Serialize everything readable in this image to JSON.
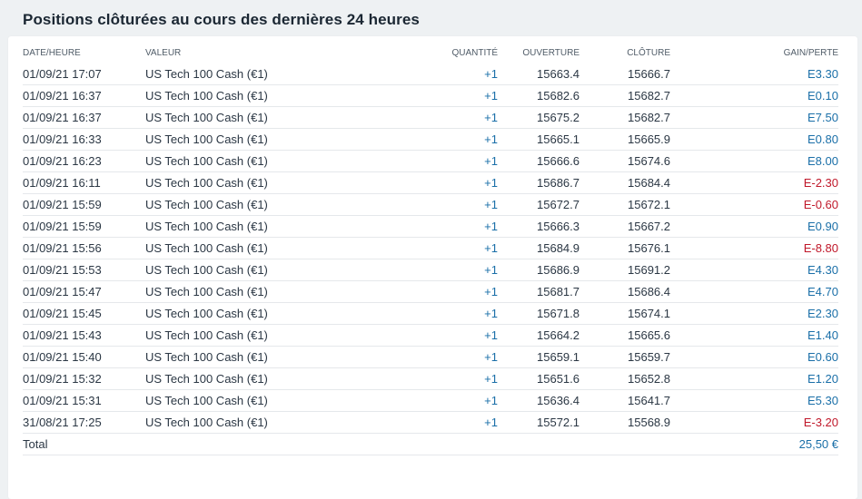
{
  "page": {
    "title": "Positions clôturées au cours des dernières 24 heures"
  },
  "table": {
    "headers": {
      "date": "DATE/HEURE",
      "value": "VALEUR",
      "quantity": "QUANTITÉ",
      "open": "OUVERTURE",
      "close": "CLÔTURE",
      "gain": "GAIN/PERTE"
    },
    "rows": [
      {
        "date": "01/09/21 17:07",
        "value": "US Tech 100 Cash (€1)",
        "qty": "+1",
        "open": "15663.4",
        "close": "15666.7",
        "gain": "E3.30",
        "sign": "pos"
      },
      {
        "date": "01/09/21 16:37",
        "value": "US Tech 100 Cash (€1)",
        "qty": "+1",
        "open": "15682.6",
        "close": "15682.7",
        "gain": "E0.10",
        "sign": "pos"
      },
      {
        "date": "01/09/21 16:37",
        "value": "US Tech 100 Cash (€1)",
        "qty": "+1",
        "open": "15675.2",
        "close": "15682.7",
        "gain": "E7.50",
        "sign": "pos"
      },
      {
        "date": "01/09/21 16:33",
        "value": "US Tech 100 Cash (€1)",
        "qty": "+1",
        "open": "15665.1",
        "close": "15665.9",
        "gain": "E0.80",
        "sign": "pos"
      },
      {
        "date": "01/09/21 16:23",
        "value": "US Tech 100 Cash (€1)",
        "qty": "+1",
        "open": "15666.6",
        "close": "15674.6",
        "gain": "E8.00",
        "sign": "pos"
      },
      {
        "date": "01/09/21 16:11",
        "value": "US Tech 100 Cash (€1)",
        "qty": "+1",
        "open": "15686.7",
        "close": "15684.4",
        "gain": "E-2.30",
        "sign": "neg"
      },
      {
        "date": "01/09/21 15:59",
        "value": "US Tech 100 Cash (€1)",
        "qty": "+1",
        "open": "15672.7",
        "close": "15672.1",
        "gain": "E-0.60",
        "sign": "neg"
      },
      {
        "date": "01/09/21 15:59",
        "value": "US Tech 100 Cash (€1)",
        "qty": "+1",
        "open": "15666.3",
        "close": "15667.2",
        "gain": "E0.90",
        "sign": "pos"
      },
      {
        "date": "01/09/21 15:56",
        "value": "US Tech 100 Cash (€1)",
        "qty": "+1",
        "open": "15684.9",
        "close": "15676.1",
        "gain": "E-8.80",
        "sign": "neg"
      },
      {
        "date": "01/09/21 15:53",
        "value": "US Tech 100 Cash (€1)",
        "qty": "+1",
        "open": "15686.9",
        "close": "15691.2",
        "gain": "E4.30",
        "sign": "pos"
      },
      {
        "date": "01/09/21 15:47",
        "value": "US Tech 100 Cash (€1)",
        "qty": "+1",
        "open": "15681.7",
        "close": "15686.4",
        "gain": "E4.70",
        "sign": "pos"
      },
      {
        "date": "01/09/21 15:45",
        "value": "US Tech 100 Cash (€1)",
        "qty": "+1",
        "open": "15671.8",
        "close": "15674.1",
        "gain": "E2.30",
        "sign": "pos"
      },
      {
        "date": "01/09/21 15:43",
        "value": "US Tech 100 Cash (€1)",
        "qty": "+1",
        "open": "15664.2",
        "close": "15665.6",
        "gain": "E1.40",
        "sign": "pos"
      },
      {
        "date": "01/09/21 15:40",
        "value": "US Tech 100 Cash (€1)",
        "qty": "+1",
        "open": "15659.1",
        "close": "15659.7",
        "gain": "E0.60",
        "sign": "pos"
      },
      {
        "date": "01/09/21 15:32",
        "value": "US Tech 100 Cash (€1)",
        "qty": "+1",
        "open": "15651.6",
        "close": "15652.8",
        "gain": "E1.20",
        "sign": "pos"
      },
      {
        "date": "01/09/21 15:31",
        "value": "US Tech 100 Cash (€1)",
        "qty": "+1",
        "open": "15636.4",
        "close": "15641.7",
        "gain": "E5.30",
        "sign": "pos"
      },
      {
        "date": "31/08/21 17:25",
        "value": "US Tech 100 Cash (€1)",
        "qty": "+1",
        "open": "15572.1",
        "close": "15568.9",
        "gain": "E-3.20",
        "sign": "neg"
      }
    ],
    "total": {
      "label": "Total",
      "value": "25,50 €"
    }
  },
  "colors": {
    "positive": "#1a6fa8",
    "negative": "#c0182a"
  }
}
